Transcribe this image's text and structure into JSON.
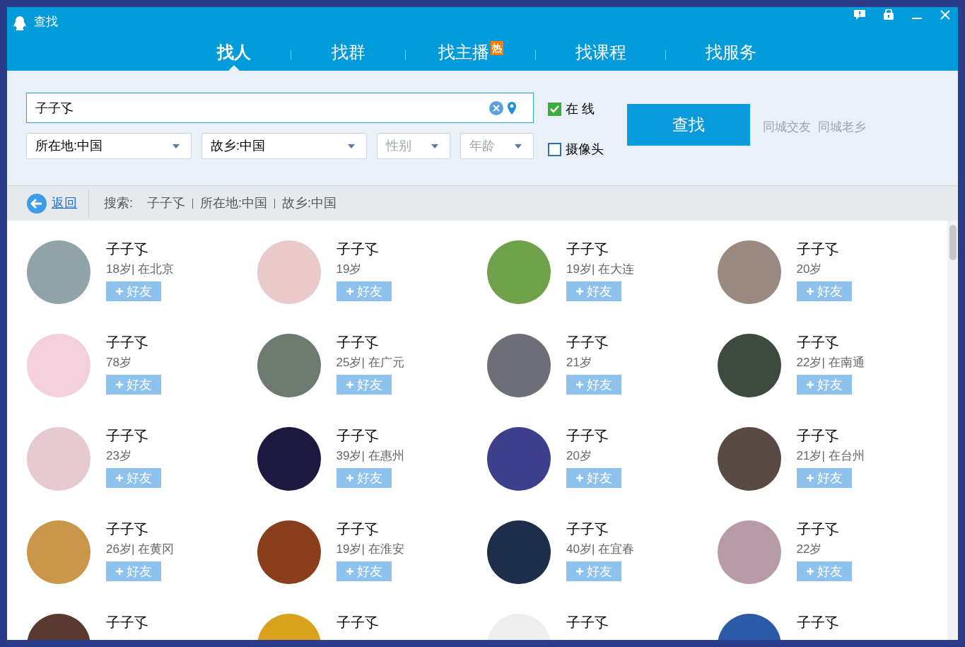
{
  "window": {
    "title": "查找"
  },
  "tabs": [
    {
      "label": "找人",
      "selected": true
    },
    {
      "label": "找群",
      "selected": false
    },
    {
      "label": "找主播",
      "selected": false,
      "badge": "热"
    },
    {
      "label": "找课程",
      "selected": false
    },
    {
      "label": "找服务",
      "selected": false
    }
  ],
  "search": {
    "value": "子子孓"
  },
  "filters": [
    {
      "value": "所在地:中国"
    },
    {
      "value": "故乡:中国"
    },
    {
      "placeholder": "性别"
    },
    {
      "placeholder": "年龄"
    }
  ],
  "options": [
    {
      "label": "在 线",
      "checked": true
    },
    {
      "label": "摄像头",
      "checked": false
    }
  ],
  "search_button": "查找",
  "links": [
    "同城交友",
    "同城老乡"
  ],
  "breadcrumb": {
    "back": "返回",
    "label": "搜索:",
    "terms": [
      "子子孓",
      "所在地:中国",
      "故乡:中国"
    ]
  },
  "results": [
    {
      "name": "子子孓",
      "info": "18岁| 在北京",
      "add": "好友"
    },
    {
      "name": "子子孓",
      "info": "19岁",
      "add": "好友"
    },
    {
      "name": "子子孓",
      "info": "19岁| 在大连",
      "add": "好友"
    },
    {
      "name": "子子孓",
      "info": "20岁",
      "add": "好友"
    },
    {
      "name": "子子孓",
      "info": "78岁",
      "add": "好友"
    },
    {
      "name": "子子孓",
      "info": "25岁| 在广元",
      "add": "好友"
    },
    {
      "name": "子子孓",
      "info": "21岁",
      "add": "好友"
    },
    {
      "name": "子子孓",
      "info": "22岁| 在南通",
      "add": "好友"
    },
    {
      "name": "子子孓",
      "info": "23岁",
      "add": "好友"
    },
    {
      "name": "子子孓",
      "info": "39岁| 在惠州",
      "add": "好友"
    },
    {
      "name": "子子孓",
      "info": "20岁",
      "add": "好友"
    },
    {
      "name": "子子孓",
      "info": "21岁| 在台州",
      "add": "好友"
    },
    {
      "name": "子子孓",
      "info": "26岁| 在黄冈",
      "add": "好友"
    },
    {
      "name": "子子孓",
      "info": "19岁| 在淮安",
      "add": "好友"
    },
    {
      "name": "子子孓",
      "info": "40岁| 在宜春",
      "add": "好友"
    },
    {
      "name": "子子孓",
      "info": "22岁",
      "add": "好友"
    },
    {
      "name": "子子孓"
    },
    {
      "name": "子子孓"
    },
    {
      "name": "子子孓"
    },
    {
      "name": "子子孓"
    }
  ]
}
